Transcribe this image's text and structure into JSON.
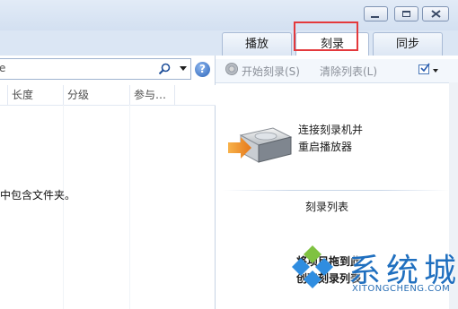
{
  "tabs": [
    {
      "label": "播放",
      "active": false
    },
    {
      "label": "刻录",
      "active": true,
      "highlighted": true
    },
    {
      "label": "同步",
      "active": false
    }
  ],
  "window_controls": {
    "minimize": "minimize-icon",
    "maximize": "maximize-icon",
    "close": "close-icon"
  },
  "search": {
    "value": "",
    "placeholder": "",
    "visible_fragment": "e"
  },
  "columns": [
    "长度",
    "分级",
    "参与…"
  ],
  "library": {
    "empty_message_fragment": "中包含文件夹。"
  },
  "burn_toolbar": {
    "start_burn": "开始刻录(S)",
    "clear_list": "清除列表(L)",
    "options_icon": "checkbox-options-icon"
  },
  "burn_status": {
    "line1": "连接刻录机并",
    "line2": "重启播放器"
  },
  "burn_list": {
    "title": "刻录列表",
    "drag_line1": "将项目拖到此",
    "drag_line2": "创建刻录列表"
  },
  "watermark": {
    "text": "系统城",
    "sub": "XITONGCHENG.COM"
  },
  "colors": {
    "highlight_box": "#e4393c",
    "help_icon": "#2b63b8",
    "watermark": "#1f6fbf"
  }
}
